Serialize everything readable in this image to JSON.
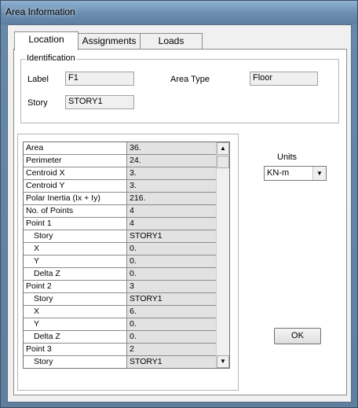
{
  "window": {
    "title": "Area Information"
  },
  "tabs": [
    {
      "label": "Location",
      "active": true
    },
    {
      "label": "Assignments",
      "active": false
    },
    {
      "label": "Loads",
      "active": false
    }
  ],
  "identification": {
    "caption": "Identification",
    "label_text": "Label",
    "label_value": "F1",
    "area_type_text": "Area Type",
    "area_type_value": "Floor",
    "story_text": "Story",
    "story_value": "STORY1"
  },
  "grid_rows": [
    {
      "name": "Area",
      "value": "36."
    },
    {
      "name": "Perimeter",
      "value": "24."
    },
    {
      "name": "Centroid X",
      "value": "3."
    },
    {
      "name": "Centroid Y",
      "value": "3."
    },
    {
      "name": "Polar Inertia (Ix + Iy)",
      "value": "216."
    },
    {
      "name": "No. of Points",
      "value": "4"
    },
    {
      "name": "Point 1",
      "value": "4"
    },
    {
      "name": "Story",
      "value": "STORY1",
      "indent": true
    },
    {
      "name": "X",
      "value": "0.",
      "indent": true
    },
    {
      "name": "Y",
      "value": "0.",
      "indent": true
    },
    {
      "name": "Delta Z",
      "value": "0.",
      "indent": true
    },
    {
      "name": "Point 2",
      "value": "3"
    },
    {
      "name": "Story",
      "value": "STORY1",
      "indent": true
    },
    {
      "name": "X",
      "value": "6.",
      "indent": true
    },
    {
      "name": "Y",
      "value": "0.",
      "indent": true
    },
    {
      "name": "Delta Z",
      "value": "0.",
      "indent": true
    },
    {
      "name": "Point 3",
      "value": "2"
    },
    {
      "name": "Story",
      "value": "STORY1",
      "indent": true
    }
  ],
  "units": {
    "label": "Units",
    "selected": "KN-m"
  },
  "buttons": {
    "ok": "OK"
  }
}
